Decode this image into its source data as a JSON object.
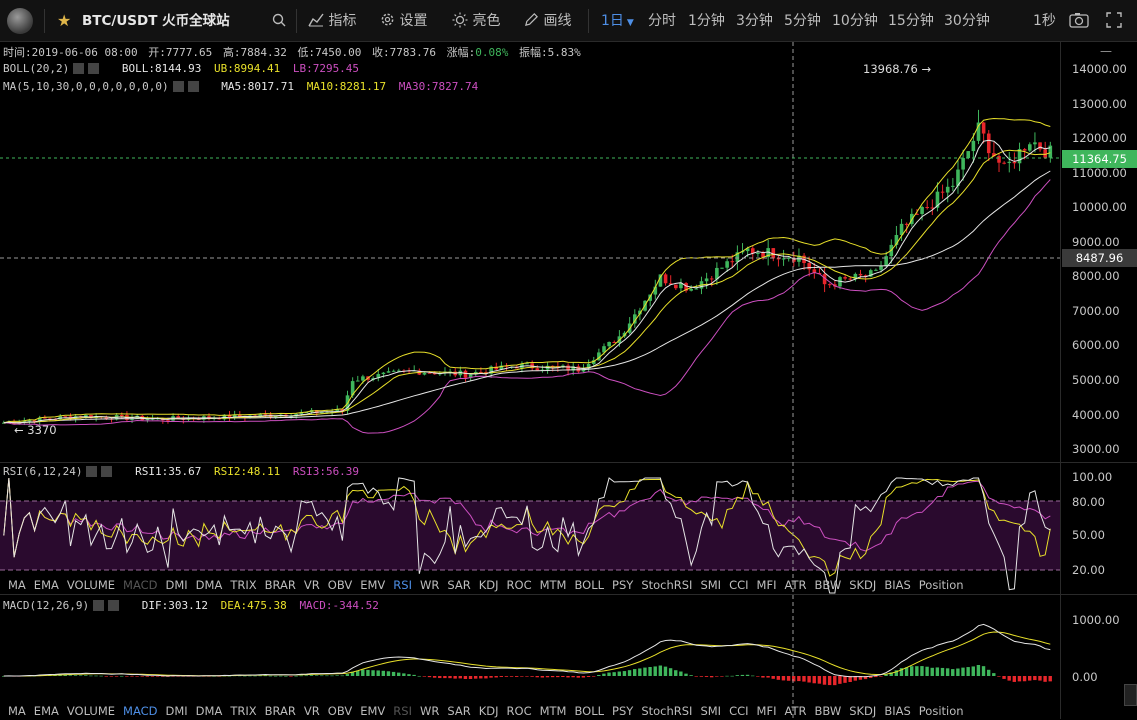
{
  "toolbar": {
    "pair": "BTC/USDT 火币全球站",
    "indicators": "指标",
    "settings": "设置",
    "theme": "亮色",
    "draw": "画线",
    "active_interval": "1日",
    "intervals": [
      "分时",
      "1分钟",
      "3分钟",
      "5分钟",
      "10分钟",
      "15分钟",
      "30分钟"
    ],
    "right_interval": "1秒"
  },
  "info_bar": {
    "time_label": "时间:",
    "time": "2019-06-06 08:00",
    "open_label": "开:",
    "open": "7777.65",
    "high_label": "高:",
    "high": "7884.32",
    "low_label": "低:",
    "low": "7450.00",
    "close_label": "收:",
    "close": "7783.76",
    "change_label": "涨幅:",
    "change": "0.08%",
    "amp_label": "振幅:",
    "amp": "5.83%"
  },
  "boll": {
    "name": "BOLL(20,2)",
    "boll": "BOLL:8144.93",
    "ub": "UB:8994.41",
    "lb": "LB:7295.45"
  },
  "ma": {
    "name": "MA(5,10,30,0,0,0,0,0,0,0)",
    "ma5": "MA5:8017.71",
    "ma10": "MA10:8281.17",
    "ma30": "MA30:7827.74"
  },
  "rsi": {
    "name": "RSI(6,12,24)",
    "rsi1": "RSI1:35.67",
    "rsi2": "RSI2:48.11",
    "rsi3": "RSI3:56.39"
  },
  "macd": {
    "name": "MACD(12,26,9)",
    "dif": "DIF:303.12",
    "dea": "DEA:475.38",
    "macd": "MACD:-344.52"
  },
  "price_axis": [
    "14000.00",
    "13000.00",
    "12000.00",
    "11000.00",
    "10000.00",
    "9000.00",
    "8000.00",
    "7000.00",
    "6000.00",
    "5000.00",
    "4000.00",
    "3000.00"
  ],
  "rsi_axis": [
    "100.00",
    "80.00",
    "50.00",
    "20.00"
  ],
  "macd_axis": [
    "1000.00",
    "0.00"
  ],
  "tags": {
    "current": "11364.75",
    "cursor": "8487.96",
    "max": "13968.76",
    "min": "3370"
  },
  "indicator_tabs": [
    "MA",
    "EMA",
    "VOLUME",
    "MACD",
    "DMI",
    "DMA",
    "TRIX",
    "BRAR",
    "VR",
    "OBV",
    "EMV",
    "RSI",
    "WR",
    "SAR",
    "KDJ",
    "ROC",
    "MTM",
    "BOLL",
    "PSY",
    "StochRSI",
    "SMI",
    "CCI",
    "MFI",
    "ATR",
    "BBW",
    "SKDJ",
    "BIAS",
    "Position"
  ],
  "colors": {
    "up": "#3fb65c",
    "down": "#e8262b",
    "ma5": "#e6e6e6",
    "ma10": "#e8e02a",
    "ma30": "#cc4fc0",
    "accent": "#4e8fe6"
  }
}
